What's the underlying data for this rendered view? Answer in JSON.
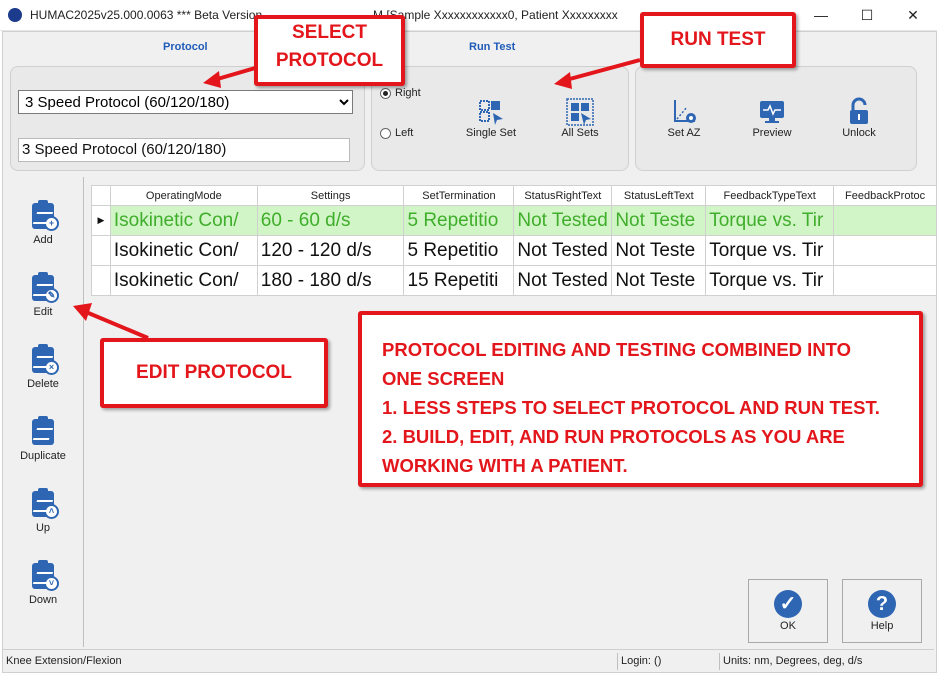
{
  "window": {
    "title": "HUMAC2025v25.000.0063 *** Beta Version",
    "title_tail": "M [Sample Xxxxxxxxxxxx0, Patient Xxxxxxxxx",
    "controls": [
      "—",
      "☐",
      "✕"
    ]
  },
  "groups": {
    "protocol_label": "Protocol",
    "run_test_label": "Run Test"
  },
  "protocol": {
    "selected": "3 Speed Protocol (60/120/180)",
    "name_field": "3 Speed Protocol (60/120/180)"
  },
  "side": {
    "right_label": "Right",
    "left_label": "Left",
    "selected": "Right"
  },
  "run_buttons": {
    "single_set": "Single Set",
    "all_sets": "All Sets"
  },
  "tools": {
    "set_az": "Set AZ",
    "preview": "Preview",
    "unlock": "Unlock"
  },
  "sidebar": {
    "items": [
      {
        "label": "Add",
        "icon": "clipboard-add-icon"
      },
      {
        "label": "Edit",
        "icon": "clipboard-edit-icon"
      },
      {
        "label": "Delete",
        "icon": "clipboard-delete-icon"
      },
      {
        "label": "Duplicate",
        "icon": "clipboard-duplicate-icon"
      },
      {
        "label": "Up",
        "icon": "clipboard-up-icon"
      },
      {
        "label": "Down",
        "icon": "clipboard-down-icon"
      }
    ]
  },
  "grid": {
    "columns": [
      "OperatingMode",
      "Settings",
      "SetTermination",
      "StatusRightText",
      "StatusLeftText",
      "FeedbackTypeText",
      "FeedbackProtoc"
    ],
    "rows": [
      [
        "Isokinetic Con/",
        "60 - 60 d/s",
        "5 Repetitio",
        "Not Tested",
        "Not Teste",
        "Torque vs. Tir",
        ""
      ],
      [
        "Isokinetic Con/",
        "120 - 120 d/s",
        "5 Repetitio",
        "Not Tested",
        "Not Teste",
        "Torque vs. Tir",
        ""
      ],
      [
        "Isokinetic Con/",
        "180 - 180 d/s",
        "15 Repetiti",
        "Not Tested",
        "Not Teste",
        "Torque vs. Tir",
        ""
      ]
    ]
  },
  "callouts": {
    "select_protocol_1": "SELECT",
    "select_protocol_2": "PROTOCOL",
    "run_test": "RUN TEST",
    "edit_protocol": "EDIT PROTOCOL",
    "summary_line1": "PROTOCOL EDITING AND TESTING COMBINED INTO",
    "summary_line2": "ONE SCREEN",
    "summary_line3": "1. LESS STEPS TO SELECT PROTOCOL AND RUN TEST.",
    "summary_line4": "2. BUILD, EDIT, AND RUN PROTOCOLS AS YOU ARE",
    "summary_line5": "WORKING WITH A PATIENT."
  },
  "dialog_buttons": {
    "ok": "OK",
    "help": "Help"
  },
  "status": {
    "joint": "Knee Extension/Flexion",
    "login": "Login:  ()",
    "units": "Units: nm, Degrees, deg, d/s"
  },
  "colors": {
    "accent": "#1f5bb8",
    "callout_red": "#e3161b",
    "selected_row_bg": "#d2f5c8",
    "selected_row_text": "#3fae2a",
    "icon_blue": "#2e66b3"
  }
}
